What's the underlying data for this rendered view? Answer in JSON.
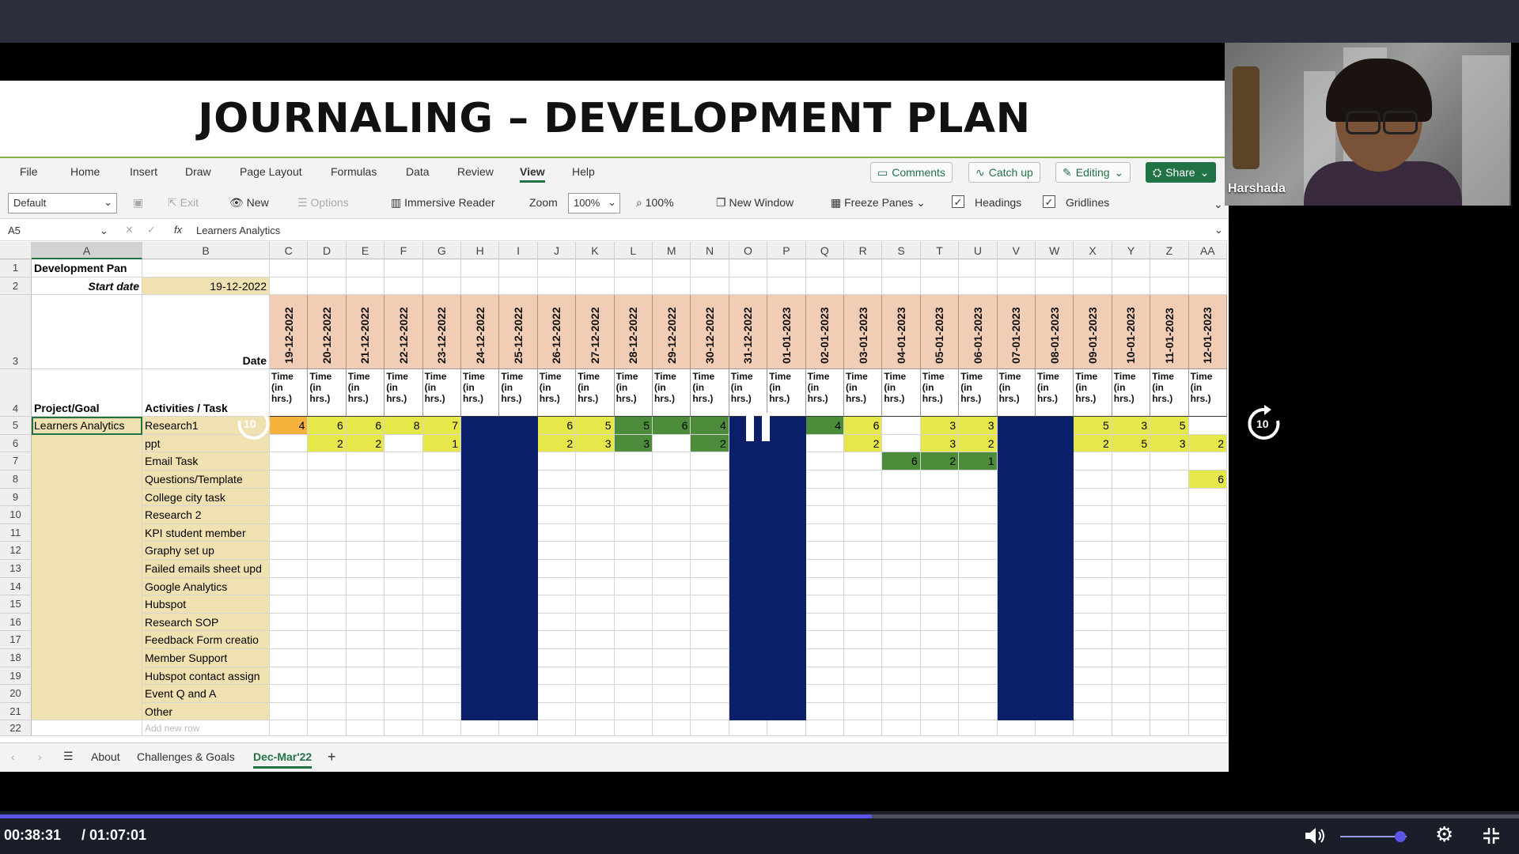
{
  "doc_title": "JOURNALING – DEVELOPMENT PLAN",
  "menu": [
    "File",
    "Home",
    "Insert",
    "Draw",
    "Page Layout",
    "Formulas",
    "Data",
    "Review",
    "View",
    "Help"
  ],
  "menu_active": "View",
  "actions": {
    "comments": "Comments",
    "catch_up": "Catch up",
    "editing": "Editing",
    "share": "Share"
  },
  "toolbar": {
    "style_select": "Default",
    "exit": "Exit",
    "new": "New",
    "options": "Options",
    "immersive_reader": "Immersive Reader",
    "zoom_label": "Zoom",
    "zoom_value": "100%",
    "zoom_100": "100%",
    "new_window": "New Window",
    "freeze_panes": "Freeze Panes",
    "headings": "Headings",
    "gridlines": "Gridlines"
  },
  "formula_bar": {
    "name_box": "A5",
    "fx": "fx",
    "content": "Learners Analytics"
  },
  "column_headers": [
    "A",
    "B",
    "C",
    "D",
    "E",
    "F",
    "G",
    "H",
    "I",
    "J",
    "K",
    "L",
    "M",
    "N",
    "O",
    "P",
    "Q",
    "R",
    "S",
    "T",
    "U",
    "V",
    "W",
    "X",
    "Y",
    "Z",
    "AA"
  ],
  "row_numbers": [
    "1",
    "2",
    "3",
    "4",
    "5",
    "6",
    "7",
    "8",
    "9",
    "10",
    "11",
    "12",
    "13",
    "14",
    "15",
    "16",
    "17",
    "18",
    "19",
    "20",
    "21",
    "22"
  ],
  "sheet": {
    "a1": "Development Pan",
    "b2_label": "Start date",
    "b2_value": "19-12-2022",
    "b3_label": "Date",
    "a4": "Project/Goal",
    "b4": "Activities / Task",
    "a5": "Learners Analytics"
  },
  "dates": [
    "19-12-2022",
    "20-12-2022",
    "21-12-2022",
    "22-12-2022",
    "23-12-2022",
    "24-12-2022",
    "25-12-2022",
    "26-12-2022",
    "27-12-2022",
    "28-12-2022",
    "29-12-2022",
    "30-12-2022",
    "31-12-2022",
    "01-01-2023",
    "02-01-2023",
    "03-01-2023",
    "04-01-2023",
    "05-01-2023",
    "06-01-2023",
    "07-01-2023",
    "08-01-2023",
    "09-01-2023",
    "10-01-2023",
    "11-01-2023",
    "12-01-2023"
  ],
  "time_header": "Time\n(in\nhrs.)",
  "weekend_columns": [
    5,
    6,
    12,
    13,
    19,
    20
  ],
  "tasks": [
    {
      "name": "Research1",
      "values": [
        "4",
        "6",
        "6",
        "8",
        "7",
        "",
        "",
        "6",
        "5",
        "5",
        "6",
        "4",
        "",
        "",
        "4",
        "6",
        "",
        "3",
        "3",
        "",
        "",
        "5",
        "3",
        "5",
        ""
      ],
      "fills": [
        "o",
        "y",
        "y",
        "y",
        "y",
        "",
        "",
        "y",
        "y",
        "g",
        "g",
        "g",
        "",
        "",
        "g",
        "y",
        "",
        "y",
        "y",
        "",
        "",
        "y",
        "y",
        "y",
        ""
      ]
    },
    {
      "name": "ppt",
      "values": [
        "",
        "2",
        "2",
        "",
        "1",
        "",
        "",
        "2",
        "3",
        "3",
        "",
        "2",
        "",
        "",
        "",
        "2",
        "",
        "3",
        "2",
        "",
        "",
        "2",
        "5",
        "3",
        "2"
      ],
      "fills": [
        "",
        "y",
        "y",
        "",
        "y",
        "",
        "",
        "y",
        "y",
        "g",
        "",
        "g",
        "",
        "",
        "",
        "y",
        "",
        "y",
        "y",
        "",
        "",
        "y",
        "y",
        "y",
        "y"
      ]
    },
    {
      "name": "Email Task",
      "values": [
        "",
        "",
        "",
        "",
        "",
        "",
        "",
        "",
        "",
        "",
        "",
        "",
        "",
        "",
        "",
        "",
        "6",
        "2",
        "1",
        "",
        "",
        "",
        "",
        "",
        ""
      ],
      "fills": [
        "",
        "",
        "",
        "",
        "",
        "",
        "",
        "",
        "",
        "",
        "",
        "",
        "",
        "",
        "",
        "",
        "g",
        "g",
        "g",
        "",
        "",
        "",
        "",
        "",
        ""
      ]
    },
    {
      "name": "Questions/Template",
      "values": [
        "",
        "",
        "",
        "",
        "",
        "",
        "",
        "",
        "",
        "",
        "",
        "",
        "",
        "",
        "",
        "",
        "",
        "",
        "",
        "",
        "",
        "",
        "",
        "",
        "6"
      ],
      "fills": [
        "",
        "",
        "",
        "",
        "",
        "",
        "",
        "",
        "",
        "",
        "",
        "",
        "",
        "",
        "",
        "",
        "",
        "",
        "",
        "",
        "",
        "",
        "",
        "",
        "y"
      ]
    },
    {
      "name": "College city task",
      "values": [],
      "fills": []
    },
    {
      "name": "Research 2",
      "values": [],
      "fills": []
    },
    {
      "name": "KPI student member",
      "values": [],
      "fills": []
    },
    {
      "name": "Graphy set up",
      "values": [],
      "fills": []
    },
    {
      "name": "Failed emails sheet upd",
      "values": [],
      "fills": []
    },
    {
      "name": "Google Analytics",
      "values": [],
      "fills": []
    },
    {
      "name": "Hubspot",
      "values": [],
      "fills": []
    },
    {
      "name": "Research SOP",
      "values": [],
      "fills": []
    },
    {
      "name": "Feedback Form creatio",
      "values": [],
      "fills": []
    },
    {
      "name": "Member Support",
      "values": [],
      "fills": []
    },
    {
      "name": "Hubspot contact assign",
      "values": [],
      "fills": []
    },
    {
      "name": "Event Q and A",
      "values": [],
      "fills": []
    },
    {
      "name": "Other",
      "values": [],
      "fills": []
    }
  ],
  "row22_placeholder": "Add new row",
  "sheet_tabs": [
    "About",
    "Challenges & Goals",
    "Dec-Mar'22"
  ],
  "active_tab": "Dec-Mar'22",
  "participant_name": "Harshada",
  "player": {
    "current": "00:38:31",
    "total": "/ 01:07:01",
    "progress": 0.574,
    "volume": 0.9,
    "rewind": "10",
    "forward": "10"
  },
  "colors": {
    "orange": "#f4b13c",
    "yellow": "#e6e84a",
    "green": "#4d8c3b",
    "navy": "#0b1f6b",
    "tan": "#efe1b0",
    "peach": "#f2cdb5",
    "accent": "#217346",
    "progress": "#5b55e6"
  }
}
